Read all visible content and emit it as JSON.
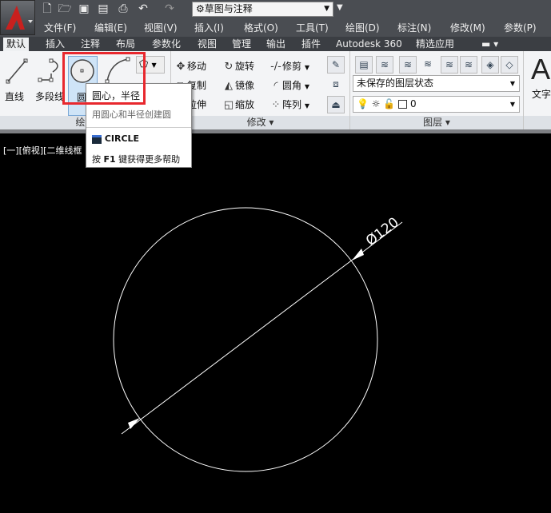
{
  "title_bar": {
    "workspace": "草图与注释",
    "quick_access": [
      "new-icon",
      "open-icon",
      "save-icon",
      "save-as-icon",
      "print-icon",
      "undo-icon",
      "redo-icon"
    ]
  },
  "menu": [
    "文件(F)",
    "编辑(E)",
    "视图(V)",
    "插入(I)",
    "格式(O)",
    "工具(T)",
    "绘图(D)",
    "标注(N)",
    "修改(M)",
    "参数(P)"
  ],
  "tabs": [
    "默认",
    "插入",
    "注释",
    "布局",
    "参数化",
    "视图",
    "管理",
    "输出",
    "插件",
    "Autodesk 360",
    "精选应用"
  ],
  "active_tab": "默认",
  "draw_panel": {
    "label": "绘图",
    "tools": [
      "直线",
      "多段线",
      "圆"
    ]
  },
  "modify_panel": {
    "label": "修改",
    "tools": [
      "移动",
      "旋转",
      "修剪",
      "复制",
      "镜像",
      "圆角",
      "拉伸",
      "缩放",
      "阵列"
    ]
  },
  "layer_panel": {
    "label": "图层",
    "layer_state": "未保存的图层状态",
    "current_layer": "0"
  },
  "annotation_panel": {
    "label": "文字"
  },
  "tooltip": {
    "title": "圆心，半径",
    "description": "用圆心和半径创建圆",
    "command": "CIRCLE",
    "help_prefix": "按",
    "help_key": "F1",
    "help_suffix": "键获得更多帮助"
  },
  "viewport": {
    "label": "[一][俯视][二维线框",
    "dimension_text": "Ø120",
    "background": "#000000",
    "line_color": "#ffffff"
  },
  "highlight_color": "#e8282e"
}
